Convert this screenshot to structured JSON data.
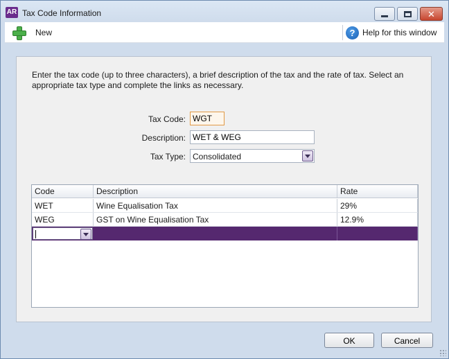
{
  "window": {
    "app_badge": "AR",
    "title": "Tax Code Information",
    "controls": [
      "minimize",
      "maximize",
      "close"
    ]
  },
  "toolbar": {
    "new_label": "New",
    "new_icon": "plus-icon",
    "help_label": "Help for this window",
    "help_icon": "help-icon"
  },
  "form": {
    "instructions": "Enter the tax code (up to three characters), a brief description of the tax and the rate of tax. Select an appropriate tax type and complete the links as necessary.",
    "tax_code_label": "Tax Code:",
    "tax_code_value": "WGT",
    "description_label": "Description:",
    "description_value": "WET & WEG",
    "tax_type_label": "Tax Type:",
    "tax_type_value": "Consolidated"
  },
  "grid": {
    "headers": [
      "Code",
      "Description",
      "Rate"
    ],
    "rows": [
      {
        "code": "WET",
        "description": "Wine Equalisation Tax",
        "rate": "29%"
      },
      {
        "code": "WEG",
        "description": "GST on Wine Equalisation Tax",
        "rate": "12.9%"
      }
    ],
    "selected_row_color": "#55286f"
  },
  "footer": {
    "ok_label": "OK",
    "cancel_label": "Cancel"
  },
  "colors": {
    "accent": "#55286f",
    "highlight_border": "#e29a45",
    "brand": "#6a2c8c"
  }
}
